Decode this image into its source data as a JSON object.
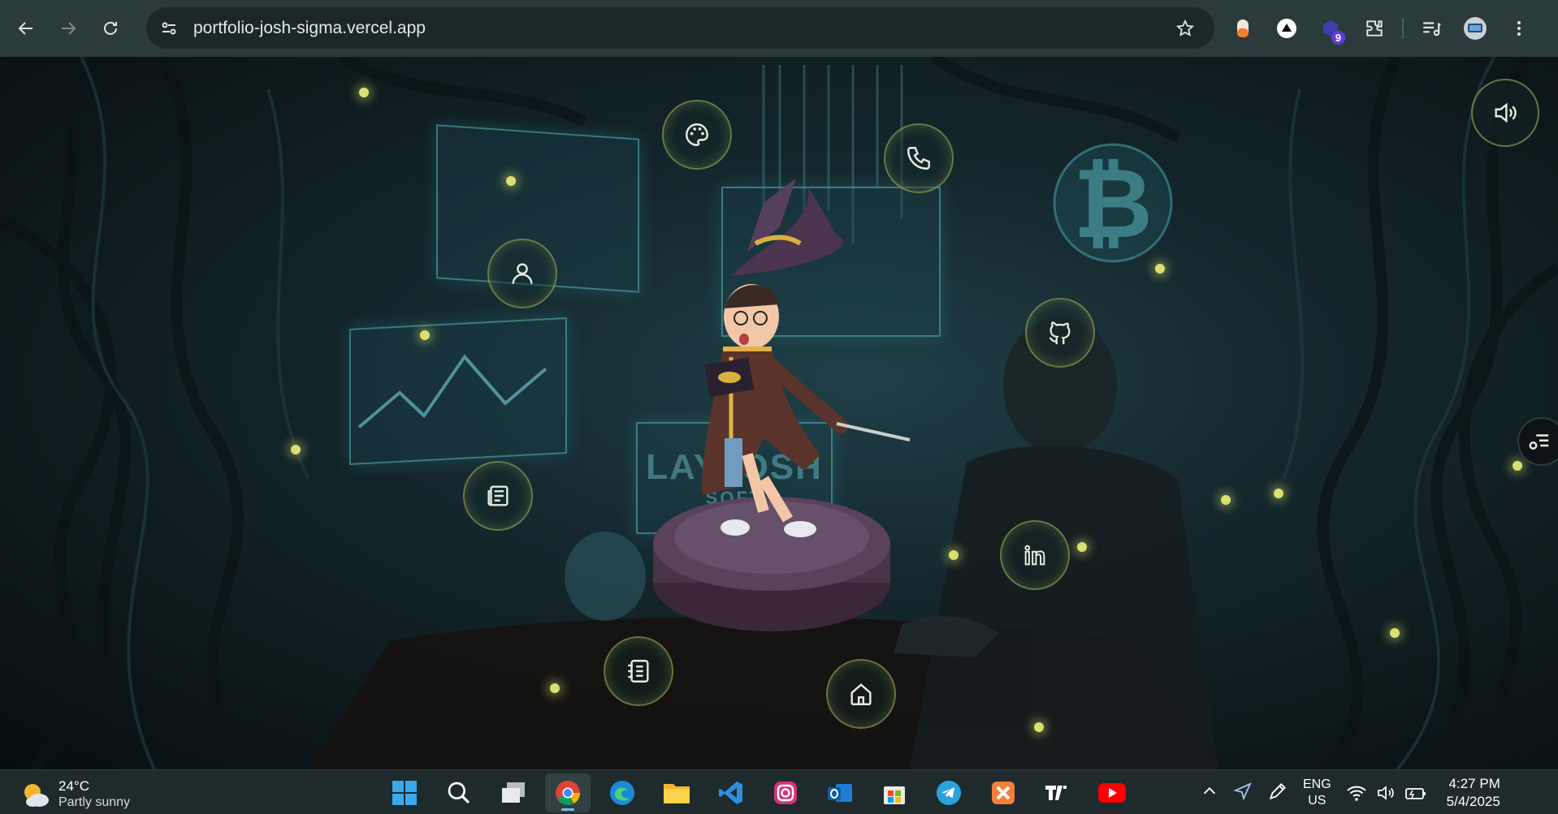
{
  "browser": {
    "url": "portfolio-josh-sigma.vercel.app",
    "extension_badge": "9",
    "icons": [
      "back-icon",
      "forward-icon",
      "reload-icon",
      "site-info-icon",
      "star-icon",
      "extensions-icon",
      "media-icon",
      "profile-icon",
      "menu-icon"
    ]
  },
  "page": {
    "background_text_top": "LAYJOSH",
    "background_text_bottom": "SOFT",
    "nav_buttons": [
      "palette-icon",
      "phone-icon",
      "user-icon",
      "github-icon",
      "newspaper-icon",
      "linkedin-icon",
      "notebook-icon",
      "home-icon"
    ],
    "accent_color": "#d8e070",
    "sound_button_icon": "volume-icon",
    "side_tab_icon": "settings-list-icon"
  },
  "taskbar": {
    "weather_temp": "24°C",
    "weather_condition": "Partly sunny",
    "apps": [
      "windows-start-icon",
      "search-icon",
      "task-view-icon",
      "chrome-icon",
      "edge-icon",
      "file-explorer-icon",
      "vscode-icon",
      "instagram-icon",
      "outlook-icon",
      "store-icon",
      "telegram-icon",
      "xampp-icon",
      "tradingview-icon",
      "youtube-icon"
    ],
    "lang_line1": "ENG",
    "lang_line2": "US",
    "time": "4:27 PM",
    "date": "5/4/2025"
  }
}
